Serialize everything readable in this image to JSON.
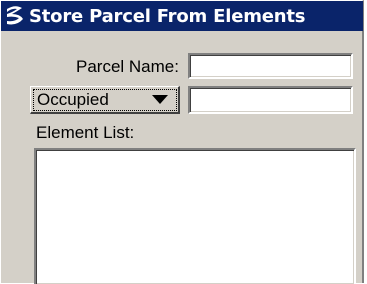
{
  "window": {
    "title": "Store Parcel From Elements",
    "icon": "bentley-b-icon",
    "titlebar_color": "#0a246a"
  },
  "form": {
    "parcel_name_label": "Parcel Name:",
    "parcel_name_value": "",
    "status_select": {
      "selected": "Occupied",
      "icon": "triangle-down-icon"
    },
    "status_value": "",
    "element_list_label": "Element List:",
    "element_list_items": []
  }
}
